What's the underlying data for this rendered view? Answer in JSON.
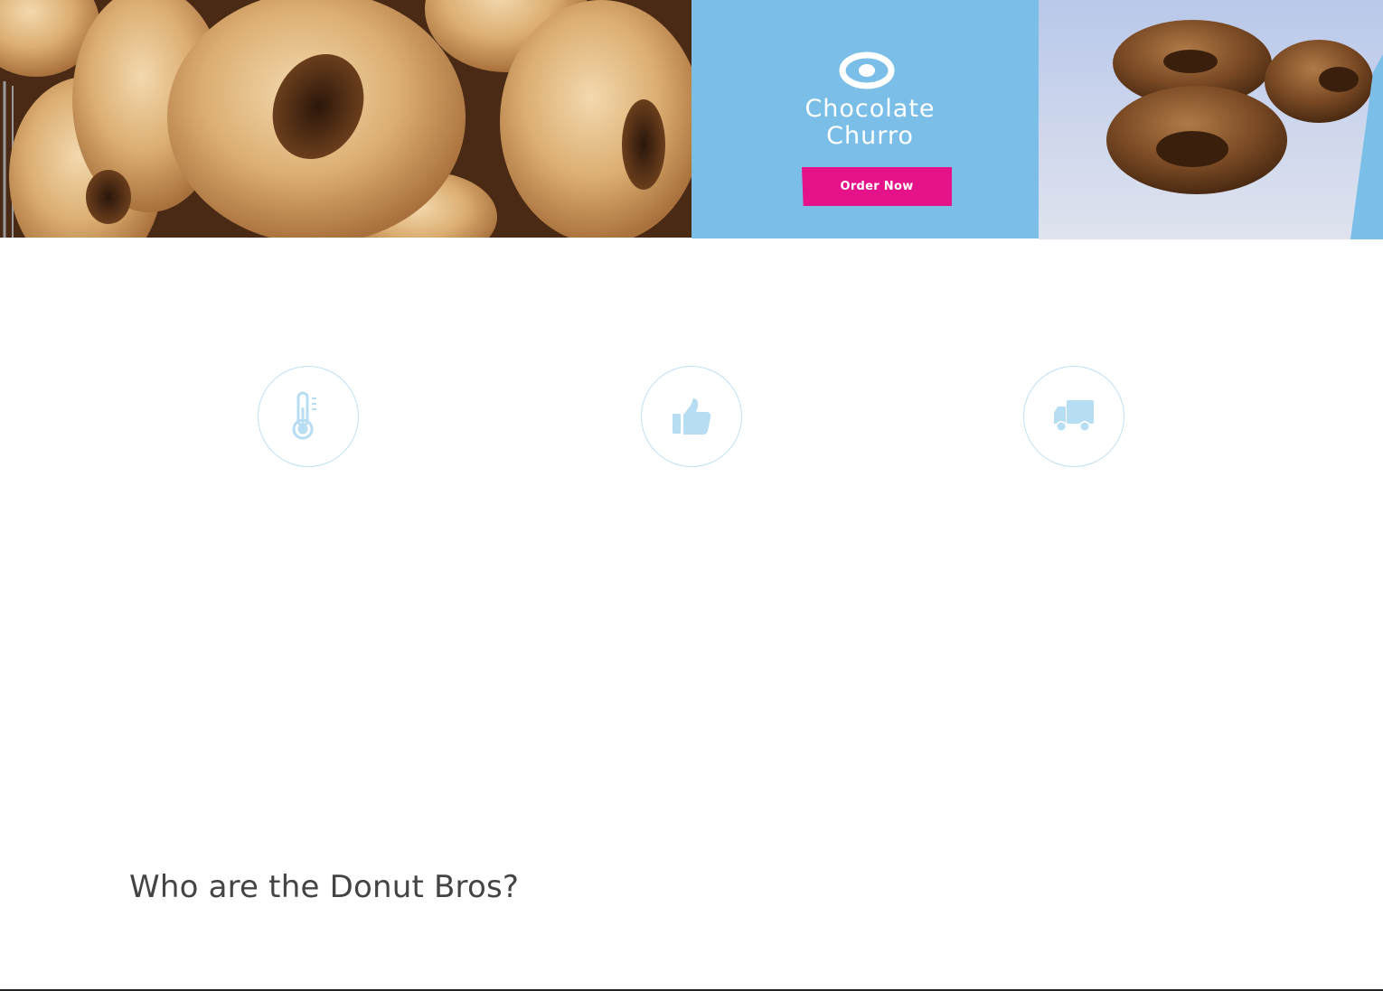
{
  "hero": {
    "left_image": "glazed-donuts-photo",
    "right_image": "chocolate-churro-donuts-photo",
    "promo": {
      "logo_icon": "donut-ring-icon",
      "title_line1": "Chocolate",
      "title_line2": "Churro",
      "button_label": "Order Now",
      "background_color": "#7bbfe8",
      "button_color": "#e5128a"
    }
  },
  "features": [
    {
      "icon": "thermometer-icon"
    },
    {
      "icon": "thumbs-up-icon"
    },
    {
      "icon": "delivery-truck-icon"
    }
  ],
  "about": {
    "title": "Who are the Donut Bros?"
  },
  "colors": {
    "accent_light_blue": "#bfe0f4",
    "heading_gray": "#444444"
  }
}
